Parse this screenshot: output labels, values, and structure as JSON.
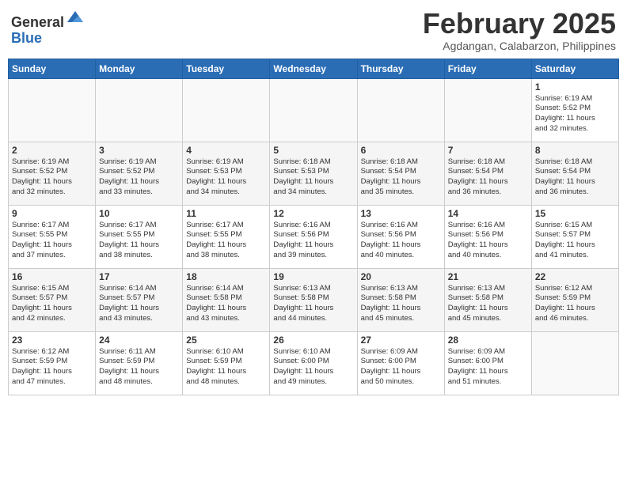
{
  "header": {
    "logo_line1": "General",
    "logo_line2": "Blue",
    "month_title": "February 2025",
    "location": "Agdangan, Calabarzon, Philippines"
  },
  "weekdays": [
    "Sunday",
    "Monday",
    "Tuesday",
    "Wednesday",
    "Thursday",
    "Friday",
    "Saturday"
  ],
  "weeks": [
    [
      {
        "day": "",
        "info": ""
      },
      {
        "day": "",
        "info": ""
      },
      {
        "day": "",
        "info": ""
      },
      {
        "day": "",
        "info": ""
      },
      {
        "day": "",
        "info": ""
      },
      {
        "day": "",
        "info": ""
      },
      {
        "day": "1",
        "info": "Sunrise: 6:19 AM\nSunset: 5:52 PM\nDaylight: 11 hours\nand 32 minutes."
      }
    ],
    [
      {
        "day": "2",
        "info": "Sunrise: 6:19 AM\nSunset: 5:52 PM\nDaylight: 11 hours\nand 32 minutes."
      },
      {
        "day": "3",
        "info": "Sunrise: 6:19 AM\nSunset: 5:52 PM\nDaylight: 11 hours\nand 33 minutes."
      },
      {
        "day": "4",
        "info": "Sunrise: 6:19 AM\nSunset: 5:53 PM\nDaylight: 11 hours\nand 34 minutes."
      },
      {
        "day": "5",
        "info": "Sunrise: 6:18 AM\nSunset: 5:53 PM\nDaylight: 11 hours\nand 34 minutes."
      },
      {
        "day": "6",
        "info": "Sunrise: 6:18 AM\nSunset: 5:54 PM\nDaylight: 11 hours\nand 35 minutes."
      },
      {
        "day": "7",
        "info": "Sunrise: 6:18 AM\nSunset: 5:54 PM\nDaylight: 11 hours\nand 36 minutes."
      },
      {
        "day": "8",
        "info": "Sunrise: 6:18 AM\nSunset: 5:54 PM\nDaylight: 11 hours\nand 36 minutes."
      }
    ],
    [
      {
        "day": "9",
        "info": "Sunrise: 6:17 AM\nSunset: 5:55 PM\nDaylight: 11 hours\nand 37 minutes."
      },
      {
        "day": "10",
        "info": "Sunrise: 6:17 AM\nSunset: 5:55 PM\nDaylight: 11 hours\nand 38 minutes."
      },
      {
        "day": "11",
        "info": "Sunrise: 6:17 AM\nSunset: 5:55 PM\nDaylight: 11 hours\nand 38 minutes."
      },
      {
        "day": "12",
        "info": "Sunrise: 6:16 AM\nSunset: 5:56 PM\nDaylight: 11 hours\nand 39 minutes."
      },
      {
        "day": "13",
        "info": "Sunrise: 6:16 AM\nSunset: 5:56 PM\nDaylight: 11 hours\nand 40 minutes."
      },
      {
        "day": "14",
        "info": "Sunrise: 6:16 AM\nSunset: 5:56 PM\nDaylight: 11 hours\nand 40 minutes."
      },
      {
        "day": "15",
        "info": "Sunrise: 6:15 AM\nSunset: 5:57 PM\nDaylight: 11 hours\nand 41 minutes."
      }
    ],
    [
      {
        "day": "16",
        "info": "Sunrise: 6:15 AM\nSunset: 5:57 PM\nDaylight: 11 hours\nand 42 minutes."
      },
      {
        "day": "17",
        "info": "Sunrise: 6:14 AM\nSunset: 5:57 PM\nDaylight: 11 hours\nand 43 minutes."
      },
      {
        "day": "18",
        "info": "Sunrise: 6:14 AM\nSunset: 5:58 PM\nDaylight: 11 hours\nand 43 minutes."
      },
      {
        "day": "19",
        "info": "Sunrise: 6:13 AM\nSunset: 5:58 PM\nDaylight: 11 hours\nand 44 minutes."
      },
      {
        "day": "20",
        "info": "Sunrise: 6:13 AM\nSunset: 5:58 PM\nDaylight: 11 hours\nand 45 minutes."
      },
      {
        "day": "21",
        "info": "Sunrise: 6:13 AM\nSunset: 5:58 PM\nDaylight: 11 hours\nand 45 minutes."
      },
      {
        "day": "22",
        "info": "Sunrise: 6:12 AM\nSunset: 5:59 PM\nDaylight: 11 hours\nand 46 minutes."
      }
    ],
    [
      {
        "day": "23",
        "info": "Sunrise: 6:12 AM\nSunset: 5:59 PM\nDaylight: 11 hours\nand 47 minutes."
      },
      {
        "day": "24",
        "info": "Sunrise: 6:11 AM\nSunset: 5:59 PM\nDaylight: 11 hours\nand 48 minutes."
      },
      {
        "day": "25",
        "info": "Sunrise: 6:10 AM\nSunset: 5:59 PM\nDaylight: 11 hours\nand 48 minutes."
      },
      {
        "day": "26",
        "info": "Sunrise: 6:10 AM\nSunset: 6:00 PM\nDaylight: 11 hours\nand 49 minutes."
      },
      {
        "day": "27",
        "info": "Sunrise: 6:09 AM\nSunset: 6:00 PM\nDaylight: 11 hours\nand 50 minutes."
      },
      {
        "day": "28",
        "info": "Sunrise: 6:09 AM\nSunset: 6:00 PM\nDaylight: 11 hours\nand 51 minutes."
      },
      {
        "day": "",
        "info": ""
      }
    ]
  ]
}
